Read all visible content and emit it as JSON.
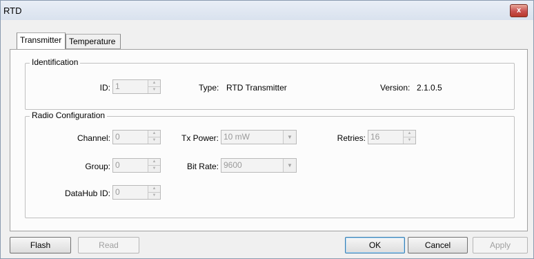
{
  "window": {
    "title": "RTD",
    "close_glyph": "x"
  },
  "tabs": [
    {
      "label": "Transmitter",
      "active": true
    },
    {
      "label": "Temperature",
      "active": false
    }
  ],
  "identification": {
    "legend": "Identification",
    "id_label": "ID:",
    "id_value": "1",
    "type_label": "Type:",
    "type_value": "RTD Transmitter",
    "version_label": "Version:",
    "version_value": "2.1.0.5"
  },
  "radio": {
    "legend": "Radio Configuration",
    "channel_label": "Channel:",
    "channel_value": "0",
    "group_label": "Group:",
    "group_value": "0",
    "datahub_label": "DataHub ID:",
    "datahub_value": "0",
    "txpower_label": "Tx Power:",
    "txpower_value": "10 mW",
    "bitrate_label": "Bit Rate:",
    "bitrate_value": "9600",
    "retries_label": "Retries:",
    "retries_value": "16"
  },
  "buttons": {
    "flash": "Flash",
    "read": "Read",
    "ok": "OK",
    "cancel": "Cancel",
    "apply": "Apply"
  }
}
